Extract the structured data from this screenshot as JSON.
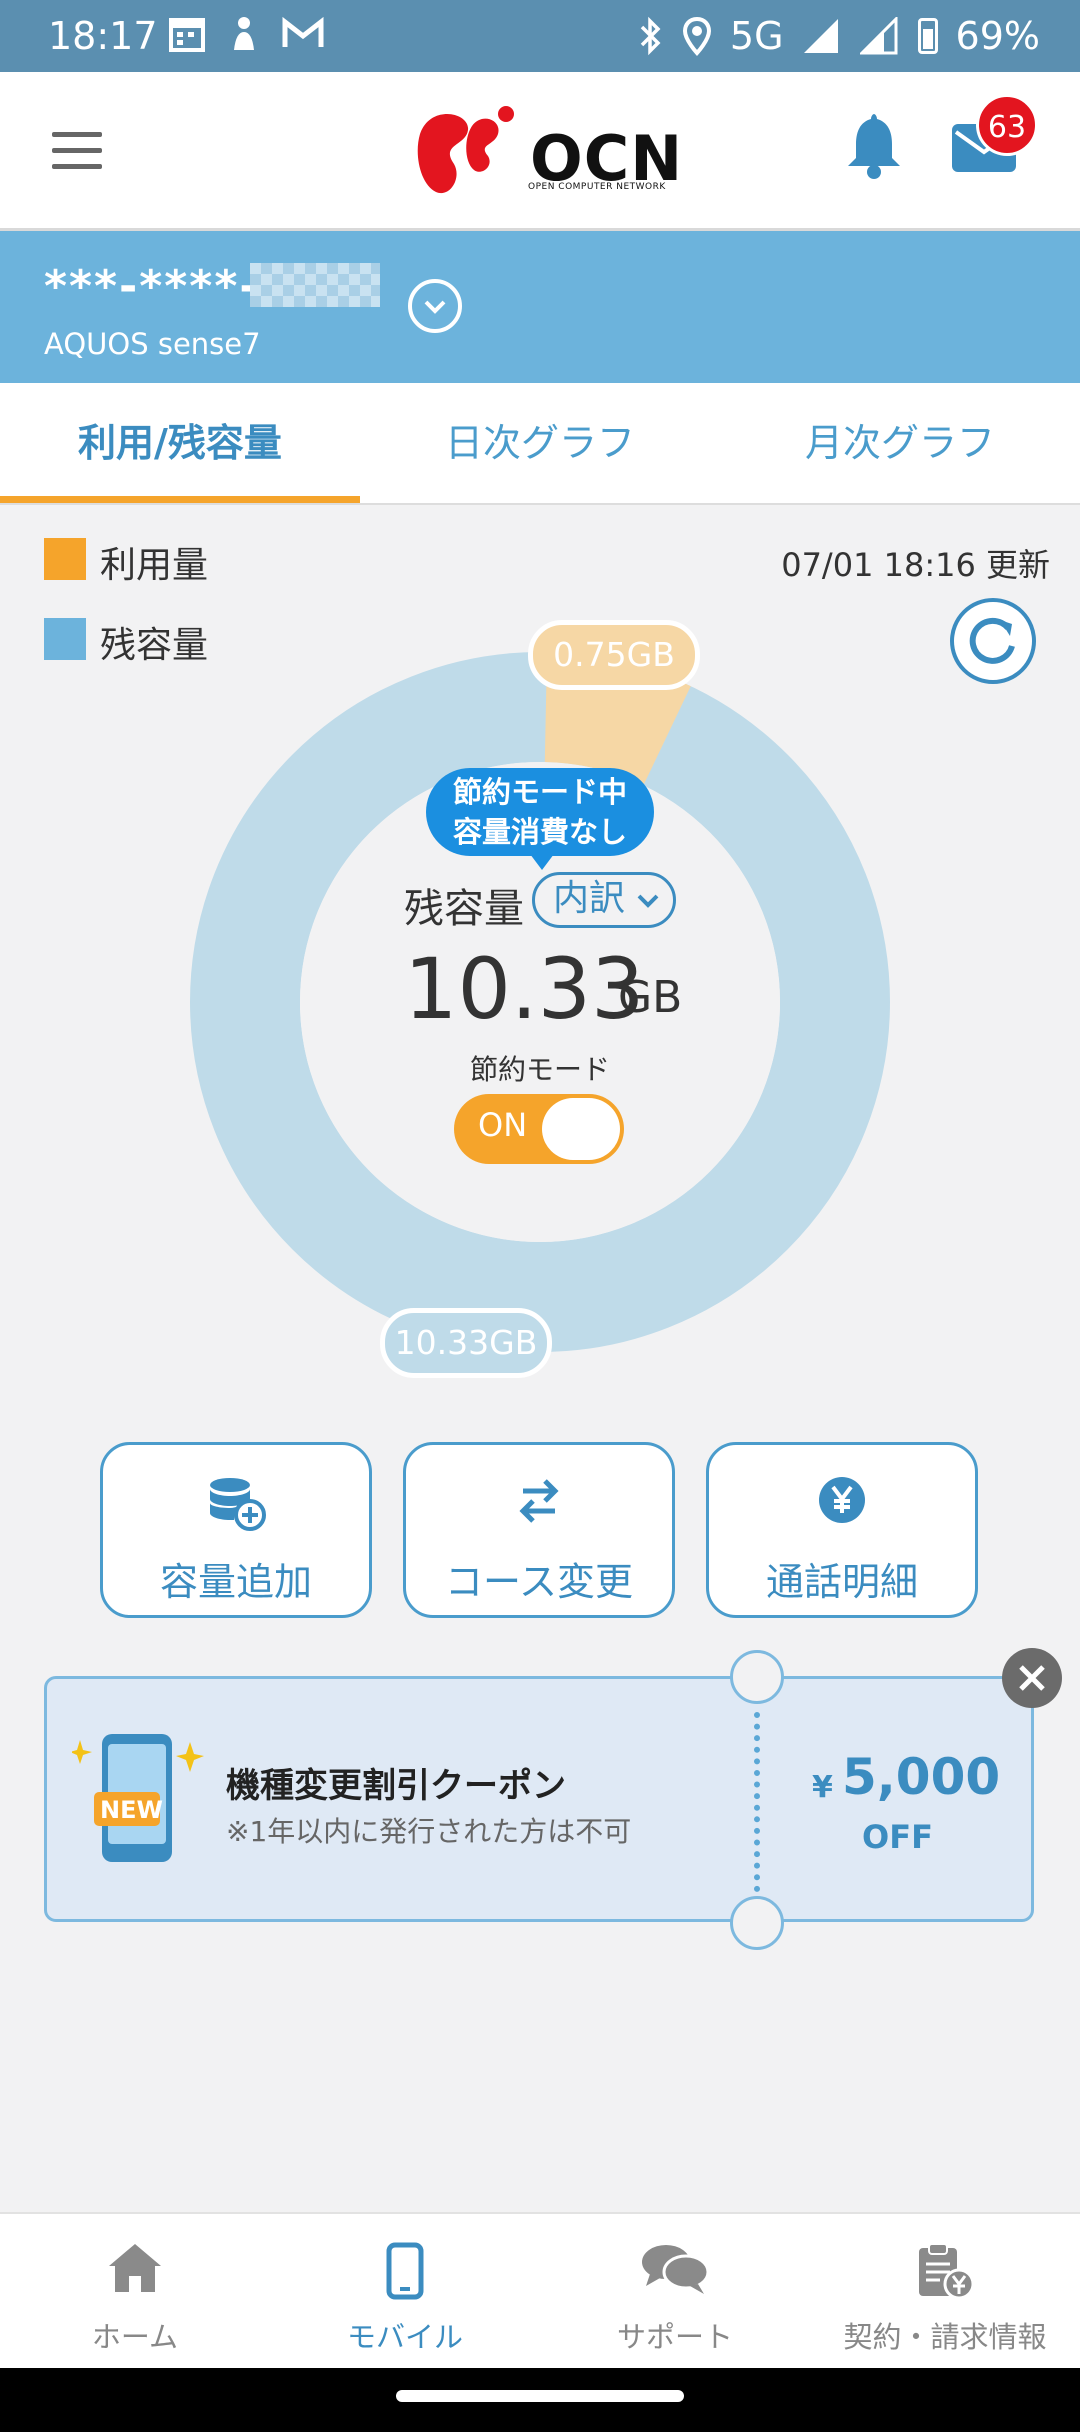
{
  "status_bar": {
    "time": "18:17",
    "network": "5G",
    "battery": "69%"
  },
  "header": {
    "logo_text": "OCN",
    "logo_sub": "OPEN COMPUTER NETWORK",
    "mail_badge": "63"
  },
  "line": {
    "number": "***-****-",
    "device": "AQUOS sense7"
  },
  "tabs": [
    {
      "label": "利用/残容量"
    },
    {
      "label": "日次グラフ"
    },
    {
      "label": "月次グラフ"
    }
  ],
  "legend": {
    "used_label": "利用量",
    "remaining_label": "残容量",
    "used_color": "#f5a42b",
    "remaining_color": "#6cb3dc"
  },
  "updated_text": "07/01 18:16 更新",
  "usage": {
    "used_pill": "0.75GB",
    "remaining_pill": "10.33GB",
    "used_gb": 0.75,
    "remaining_gb": 10.33,
    "tip_line1": "節約モード中",
    "tip_line2": "容量消費なし",
    "remaining_label": "残容量",
    "breakdown_label": "内訳",
    "big_value": "10.33",
    "big_unit": "GB",
    "save_mode_label": "節約モード",
    "toggle_label": "ON"
  },
  "actions": [
    {
      "label": "容量追加",
      "icon": "database-add-icon"
    },
    {
      "label": "コース変更",
      "icon": "swap-arrows-icon"
    },
    {
      "label": "通話明細",
      "icon": "yen-circle-icon"
    }
  ],
  "coupon": {
    "badge": "NEW",
    "title": "機種変更割引クーポン",
    "note": "※1年以内に発行された方は不可",
    "yen": "¥",
    "amount": "5,000",
    "off": "OFF"
  },
  "bottom_nav": [
    {
      "label": "ホーム",
      "icon": "home-icon"
    },
    {
      "label": "モバイル",
      "icon": "mobile-icon"
    },
    {
      "label": "サポート",
      "icon": "chat-icon"
    },
    {
      "label": "契約・請求情報",
      "icon": "contract-icon"
    }
  ]
}
